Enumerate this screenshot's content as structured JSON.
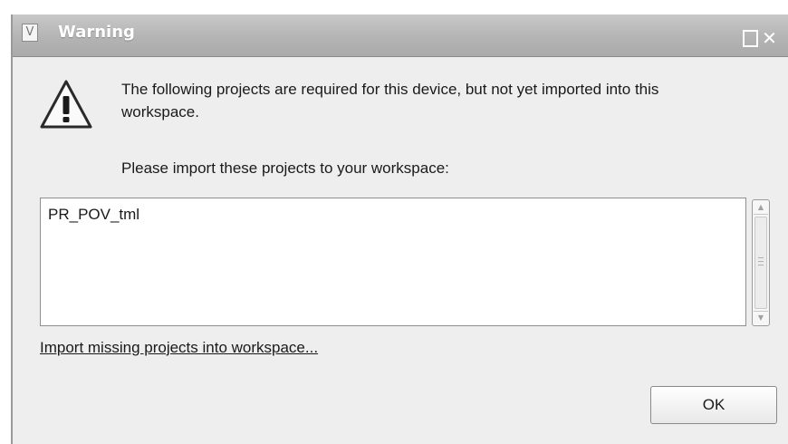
{
  "window": {
    "title": "Warning",
    "app_icon_letter": "V"
  },
  "message": {
    "text": "The following projects are required for this device, but not yet imported into this workspace.",
    "prompt": "Please import these projects to your workspace:"
  },
  "projects": {
    "items": [
      "PR_POV_tml"
    ]
  },
  "actions": {
    "import_link": "Import missing projects into workspace...",
    "ok_label": "OK"
  },
  "icons": {
    "warning": "warning-triangle-icon",
    "maximize": "maximize-icon",
    "close": "close-icon"
  }
}
